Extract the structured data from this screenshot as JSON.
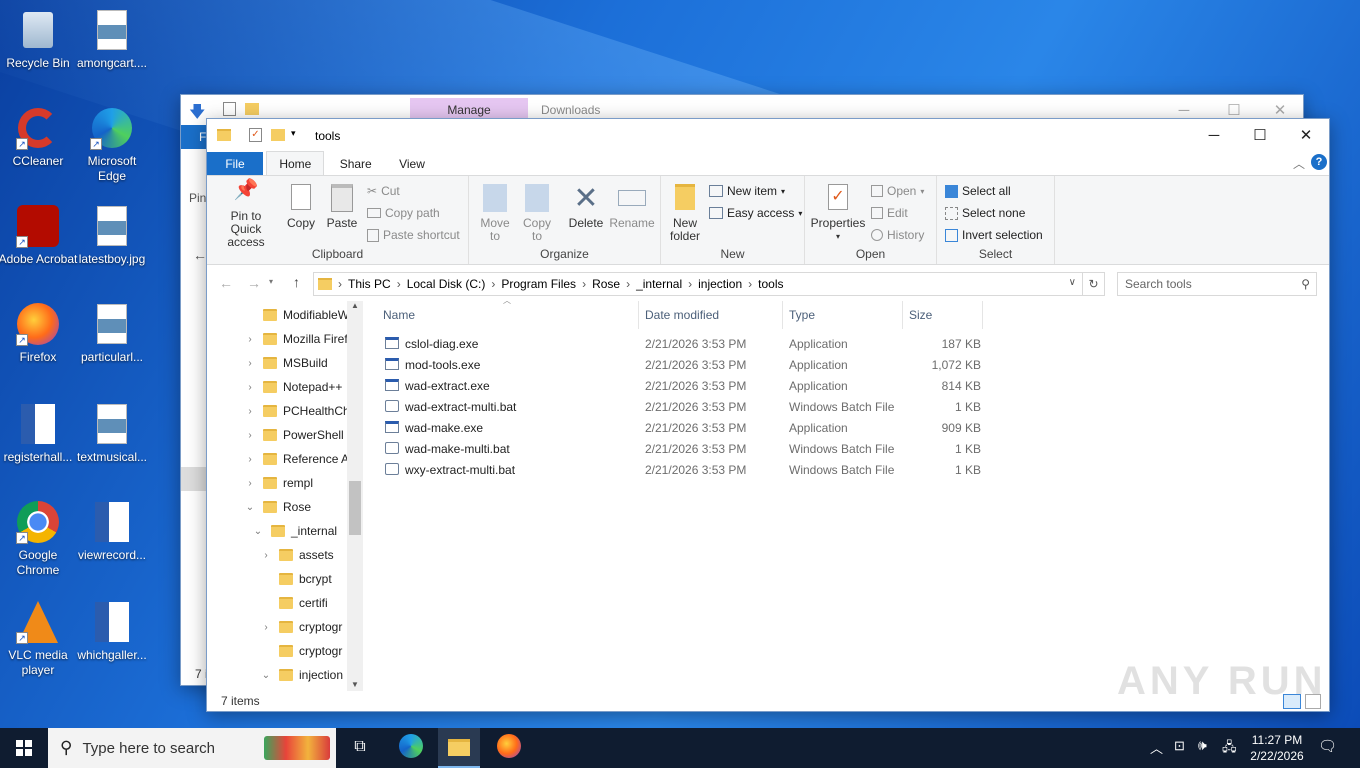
{
  "desktop": {
    "icons": [
      {
        "label": "Recycle Bin",
        "icon": "recycle-bin-icon"
      },
      {
        "label": "amongcart....",
        "icon": "image-file-icon"
      },
      {
        "label": "CCleaner",
        "icon": "ccleaner-icon"
      },
      {
        "label": "Microsoft Edge",
        "icon": "edge-icon"
      },
      {
        "label": "Adobe Acrobat",
        "icon": "acrobat-icon"
      },
      {
        "label": "latestboy.jpg",
        "icon": "image-file-icon"
      },
      {
        "label": "Firefox",
        "icon": "firefox-icon"
      },
      {
        "label": "particularl...",
        "icon": "image-file-icon"
      },
      {
        "label": "registerhall...",
        "icon": "word-doc-icon"
      },
      {
        "label": "textmusical...",
        "icon": "image-file-icon"
      },
      {
        "label": "Google Chrome",
        "icon": "chrome-icon"
      },
      {
        "label": "viewrecord...",
        "icon": "word-doc-icon"
      },
      {
        "label": "VLC media player",
        "icon": "vlc-icon"
      },
      {
        "label": "whichgaller...",
        "icon": "word-doc-icon"
      }
    ]
  },
  "back_window": {
    "manage_tab": "Manage",
    "title": "Downloads",
    "file_tab": "F",
    "pin_label": "Pin",
    "status": "7 i"
  },
  "window": {
    "title": "tools",
    "tabs": {
      "file": "File",
      "home": "Home",
      "share": "Share",
      "view": "View"
    },
    "ribbon": {
      "clipboard": {
        "pin": "Pin to Quick access",
        "copy": "Copy",
        "paste": "Paste",
        "cut": "Cut",
        "copy_path": "Copy path",
        "paste_shortcut": "Paste shortcut",
        "group": "Clipboard"
      },
      "organize": {
        "move_to": "Move to",
        "copy_to": "Copy to",
        "delete": "Delete",
        "rename": "Rename",
        "group": "Organize"
      },
      "new": {
        "new_folder": "New folder",
        "new_item": "New item",
        "easy_access": "Easy access",
        "group": "New"
      },
      "open": {
        "properties": "Properties",
        "open": "Open",
        "edit": "Edit",
        "history": "History",
        "group": "Open"
      },
      "select": {
        "select_all": "Select all",
        "select_none": "Select none",
        "invert": "Invert selection",
        "group": "Select"
      }
    },
    "breadcrumb": [
      "This PC",
      "Local Disk (C:)",
      "Program Files",
      "Rose",
      "_internal",
      "injection",
      "tools"
    ],
    "search_placeholder": "Search tools",
    "tree": [
      {
        "label": "ModifiableW",
        "level": 0,
        "expand": ""
      },
      {
        "label": "Mozilla Firef",
        "level": 0,
        "expand": ">"
      },
      {
        "label": "MSBuild",
        "level": 0,
        "expand": ">"
      },
      {
        "label": "Notepad++",
        "level": 0,
        "expand": ">"
      },
      {
        "label": "PCHealthCh",
        "level": 0,
        "expand": ">"
      },
      {
        "label": "PowerShell",
        "level": 0,
        "expand": ">"
      },
      {
        "label": "Reference A",
        "level": 0,
        "expand": ">"
      },
      {
        "label": "rempl",
        "level": 0,
        "expand": ">"
      },
      {
        "label": "Rose",
        "level": 0,
        "expand": "v"
      },
      {
        "label": "_internal",
        "level": 1,
        "expand": "v"
      },
      {
        "label": "assets",
        "level": 2,
        "expand": ">"
      },
      {
        "label": "bcrypt",
        "level": 2,
        "expand": ""
      },
      {
        "label": "certifi",
        "level": 2,
        "expand": ""
      },
      {
        "label": "cryptogr",
        "level": 2,
        "expand": ">"
      },
      {
        "label": "cryptogr",
        "level": 2,
        "expand": ""
      },
      {
        "label": "injection",
        "level": 2,
        "expand": "v"
      }
    ],
    "columns": {
      "name": "Name",
      "date": "Date modified",
      "type": "Type",
      "size": "Size"
    },
    "files": [
      {
        "name": "cslol-diag.exe",
        "date": "2/21/2026 3:53 PM",
        "type": "Application",
        "size": "187 KB",
        "kind": "exe"
      },
      {
        "name": "mod-tools.exe",
        "date": "2/21/2026 3:53 PM",
        "type": "Application",
        "size": "1,072 KB",
        "kind": "exe"
      },
      {
        "name": "wad-extract.exe",
        "date": "2/21/2026 3:53 PM",
        "type": "Application",
        "size": "814 KB",
        "kind": "exe"
      },
      {
        "name": "wad-extract-multi.bat",
        "date": "2/21/2026 3:53 PM",
        "type": "Windows Batch File",
        "size": "1 KB",
        "kind": "bat"
      },
      {
        "name": "wad-make.exe",
        "date": "2/21/2026 3:53 PM",
        "type": "Application",
        "size": "909 KB",
        "kind": "exe"
      },
      {
        "name": "wad-make-multi.bat",
        "date": "2/21/2026 3:53 PM",
        "type": "Windows Batch File",
        "size": "1 KB",
        "kind": "bat"
      },
      {
        "name": "wxy-extract-multi.bat",
        "date": "2/21/2026 3:53 PM",
        "type": "Windows Batch File",
        "size": "1 KB",
        "kind": "bat"
      }
    ],
    "status": "7 items"
  },
  "watermark": "ANY RUN",
  "taskbar": {
    "search_placeholder": "Type here to search",
    "time": "11:27 PM",
    "date": "2/22/2026"
  },
  "colors": {
    "accent": "#1a6fc9",
    "folder": "#f5cd62",
    "taskbar": "#0f1c30",
    "manage_tab": "#e6c7f2"
  }
}
